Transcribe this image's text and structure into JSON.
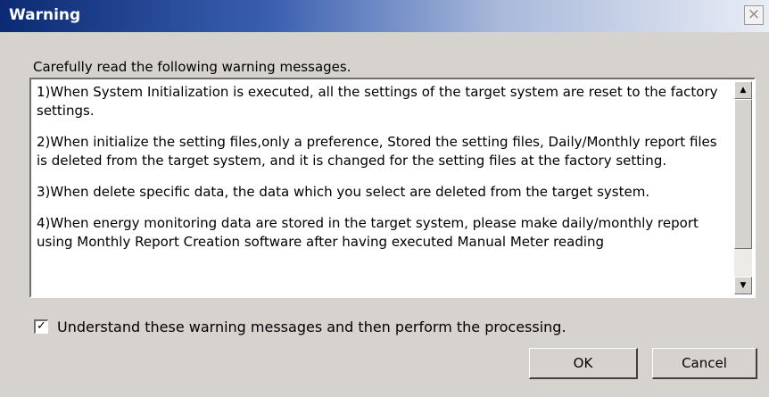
{
  "window": {
    "title": "Warning",
    "close_icon": "×"
  },
  "instruction": "Carefully read the following warning messages.",
  "messages": [
    "1)When System Initialization is executed, all the settings of the target system are reset to the factory settings.",
    "2)When initialize the setting files,only a preference, Stored the setting files, Daily/Monthly report files is deleted from the target system, and it is changed for the setting files at the factory setting.",
    "3)When delete specific data, the data which you select are deleted from the target system.",
    "4)When energy monitoring data are stored in the target system, please make daily/monthly report using Monthly Report Creation software after having executed Manual Meter reading"
  ],
  "scrollbar": {
    "up_icon": "▲",
    "down_icon": "▼"
  },
  "confirm": {
    "checked": true,
    "check_mark": "✓",
    "label": "Understand these warning messages and then perform the processing."
  },
  "buttons": {
    "ok": "OK",
    "cancel": "Cancel"
  }
}
